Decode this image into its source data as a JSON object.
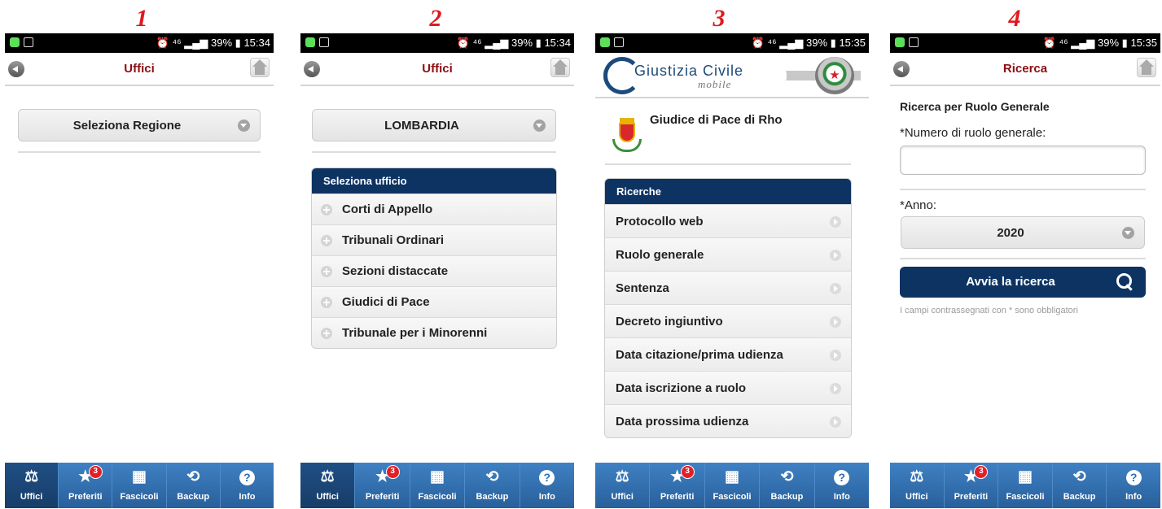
{
  "step_labels": [
    "1",
    "2",
    "3",
    "4"
  ],
  "status": {
    "time_1": "15:34",
    "time_2": "15:34",
    "time_3": "15:35",
    "time_4": "15:35",
    "network": "⁴⁶",
    "battery": "39%"
  },
  "tabs": [
    {
      "label": "Uffici",
      "icon": "scales-icon"
    },
    {
      "label": "Preferiti",
      "icon": "star-icon",
      "badge": "3"
    },
    {
      "label": "Fascicoli",
      "icon": "folder-icon"
    },
    {
      "label": "Backup",
      "icon": "backup-icon"
    },
    {
      "label": "Info",
      "icon": "help-icon"
    }
  ],
  "screen1": {
    "title": "Uffici",
    "region_select": "Seleziona Regione"
  },
  "screen2": {
    "title": "Uffici",
    "region_select": "LOMBARDIA",
    "list_title": "Seleziona ufficio",
    "items": [
      "Corti di Appello",
      "Tribunali Ordinari",
      "Sezioni distaccate",
      "Giudici di Pace",
      "Tribunale per i Minorenni"
    ]
  },
  "screen3": {
    "brand_main": "Giustizia Civile",
    "brand_sub": "mobile",
    "office_name": "Giudice di Pace di Rho",
    "list_title": "Ricerche",
    "items": [
      "Protocollo web",
      "Ruolo generale",
      "Sentenza",
      "Decreto ingiuntivo",
      "Data citazione/prima udienza",
      "Data iscrizione a ruolo",
      "Data prossima udienza"
    ]
  },
  "screen4": {
    "title": "Ricerca",
    "heading": "Ricerca per Ruolo Generale",
    "field_label": "*Numero di ruolo generale:",
    "field_value": "",
    "year_label": "*Anno:",
    "year_value": "2020",
    "search_button": "Avvia la ricerca",
    "note": "I campi contrassegnati con * sono obbligatori"
  },
  "colors": {
    "accent_red": "#e0191e",
    "title_red": "#8b0e12",
    "navy": "#0d3362",
    "tab_blue": "#2b6fb3"
  }
}
